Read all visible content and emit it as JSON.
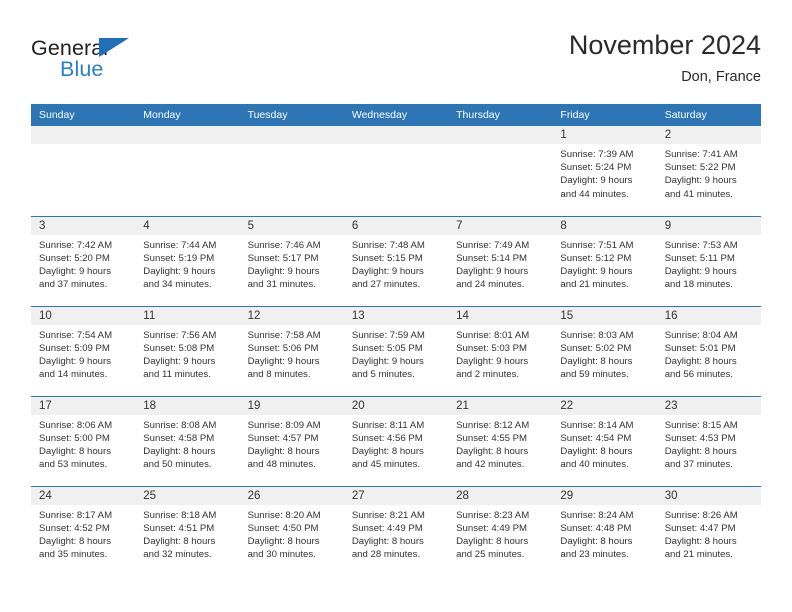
{
  "logo": {
    "word_primary": "General",
    "word_secondary": "Blue",
    "triangle_icon": "triangle-icon",
    "primary_color": "#231f20",
    "secondary_color": "#2a7fc9",
    "triangle_color": "#1f6fba"
  },
  "header": {
    "title": "November 2024",
    "subtitle": "Don, France",
    "accent_color": "#2e75b6"
  },
  "calendar": {
    "weekday_headers": [
      "Sunday",
      "Monday",
      "Tuesday",
      "Wednesday",
      "Thursday",
      "Friday",
      "Saturday"
    ],
    "header_bg": "#2e75b6",
    "header_text_color": "#ffffff",
    "daynum_band_bg": "#f0f0f0",
    "row_border_color": "#2e75b6",
    "weeks": [
      [
        {
          "day": "",
          "lines": []
        },
        {
          "day": "",
          "lines": []
        },
        {
          "day": "",
          "lines": []
        },
        {
          "day": "",
          "lines": []
        },
        {
          "day": "",
          "lines": []
        },
        {
          "day": "1",
          "lines": [
            "Sunrise: 7:39 AM",
            "Sunset: 5:24 PM",
            "Daylight: 9 hours",
            "and 44 minutes."
          ]
        },
        {
          "day": "2",
          "lines": [
            "Sunrise: 7:41 AM",
            "Sunset: 5:22 PM",
            "Daylight: 9 hours",
            "and 41 minutes."
          ]
        }
      ],
      [
        {
          "day": "3",
          "lines": [
            "Sunrise: 7:42 AM",
            "Sunset: 5:20 PM",
            "Daylight: 9 hours",
            "and 37 minutes."
          ]
        },
        {
          "day": "4",
          "lines": [
            "Sunrise: 7:44 AM",
            "Sunset: 5:19 PM",
            "Daylight: 9 hours",
            "and 34 minutes."
          ]
        },
        {
          "day": "5",
          "lines": [
            "Sunrise: 7:46 AM",
            "Sunset: 5:17 PM",
            "Daylight: 9 hours",
            "and 31 minutes."
          ]
        },
        {
          "day": "6",
          "lines": [
            "Sunrise: 7:48 AM",
            "Sunset: 5:15 PM",
            "Daylight: 9 hours",
            "and 27 minutes."
          ]
        },
        {
          "day": "7",
          "lines": [
            "Sunrise: 7:49 AM",
            "Sunset: 5:14 PM",
            "Daylight: 9 hours",
            "and 24 minutes."
          ]
        },
        {
          "day": "8",
          "lines": [
            "Sunrise: 7:51 AM",
            "Sunset: 5:12 PM",
            "Daylight: 9 hours",
            "and 21 minutes."
          ]
        },
        {
          "day": "9",
          "lines": [
            "Sunrise: 7:53 AM",
            "Sunset: 5:11 PM",
            "Daylight: 9 hours",
            "and 18 minutes."
          ]
        }
      ],
      [
        {
          "day": "10",
          "lines": [
            "Sunrise: 7:54 AM",
            "Sunset: 5:09 PM",
            "Daylight: 9 hours",
            "and 14 minutes."
          ]
        },
        {
          "day": "11",
          "lines": [
            "Sunrise: 7:56 AM",
            "Sunset: 5:08 PM",
            "Daylight: 9 hours",
            "and 11 minutes."
          ]
        },
        {
          "day": "12",
          "lines": [
            "Sunrise: 7:58 AM",
            "Sunset: 5:06 PM",
            "Daylight: 9 hours",
            "and 8 minutes."
          ]
        },
        {
          "day": "13",
          "lines": [
            "Sunrise: 7:59 AM",
            "Sunset: 5:05 PM",
            "Daylight: 9 hours",
            "and 5 minutes."
          ]
        },
        {
          "day": "14",
          "lines": [
            "Sunrise: 8:01 AM",
            "Sunset: 5:03 PM",
            "Daylight: 9 hours",
            "and 2 minutes."
          ]
        },
        {
          "day": "15",
          "lines": [
            "Sunrise: 8:03 AM",
            "Sunset: 5:02 PM",
            "Daylight: 8 hours",
            "and 59 minutes."
          ]
        },
        {
          "day": "16",
          "lines": [
            "Sunrise: 8:04 AM",
            "Sunset: 5:01 PM",
            "Daylight: 8 hours",
            "and 56 minutes."
          ]
        }
      ],
      [
        {
          "day": "17",
          "lines": [
            "Sunrise: 8:06 AM",
            "Sunset: 5:00 PM",
            "Daylight: 8 hours",
            "and 53 minutes."
          ]
        },
        {
          "day": "18",
          "lines": [
            "Sunrise: 8:08 AM",
            "Sunset: 4:58 PM",
            "Daylight: 8 hours",
            "and 50 minutes."
          ]
        },
        {
          "day": "19",
          "lines": [
            "Sunrise: 8:09 AM",
            "Sunset: 4:57 PM",
            "Daylight: 8 hours",
            "and 48 minutes."
          ]
        },
        {
          "day": "20",
          "lines": [
            "Sunrise: 8:11 AM",
            "Sunset: 4:56 PM",
            "Daylight: 8 hours",
            "and 45 minutes."
          ]
        },
        {
          "day": "21",
          "lines": [
            "Sunrise: 8:12 AM",
            "Sunset: 4:55 PM",
            "Daylight: 8 hours",
            "and 42 minutes."
          ]
        },
        {
          "day": "22",
          "lines": [
            "Sunrise: 8:14 AM",
            "Sunset: 4:54 PM",
            "Daylight: 8 hours",
            "and 40 minutes."
          ]
        },
        {
          "day": "23",
          "lines": [
            "Sunrise: 8:15 AM",
            "Sunset: 4:53 PM",
            "Daylight: 8 hours",
            "and 37 minutes."
          ]
        }
      ],
      [
        {
          "day": "24",
          "lines": [
            "Sunrise: 8:17 AM",
            "Sunset: 4:52 PM",
            "Daylight: 8 hours",
            "and 35 minutes."
          ]
        },
        {
          "day": "25",
          "lines": [
            "Sunrise: 8:18 AM",
            "Sunset: 4:51 PM",
            "Daylight: 8 hours",
            "and 32 minutes."
          ]
        },
        {
          "day": "26",
          "lines": [
            "Sunrise: 8:20 AM",
            "Sunset: 4:50 PM",
            "Daylight: 8 hours",
            "and 30 minutes."
          ]
        },
        {
          "day": "27",
          "lines": [
            "Sunrise: 8:21 AM",
            "Sunset: 4:49 PM",
            "Daylight: 8 hours",
            "and 28 minutes."
          ]
        },
        {
          "day": "28",
          "lines": [
            "Sunrise: 8:23 AM",
            "Sunset: 4:49 PM",
            "Daylight: 8 hours",
            "and 25 minutes."
          ]
        },
        {
          "day": "29",
          "lines": [
            "Sunrise: 8:24 AM",
            "Sunset: 4:48 PM",
            "Daylight: 8 hours",
            "and 23 minutes."
          ]
        },
        {
          "day": "30",
          "lines": [
            "Sunrise: 8:26 AM",
            "Sunset: 4:47 PM",
            "Daylight: 8 hours",
            "and 21 minutes."
          ]
        }
      ]
    ]
  }
}
